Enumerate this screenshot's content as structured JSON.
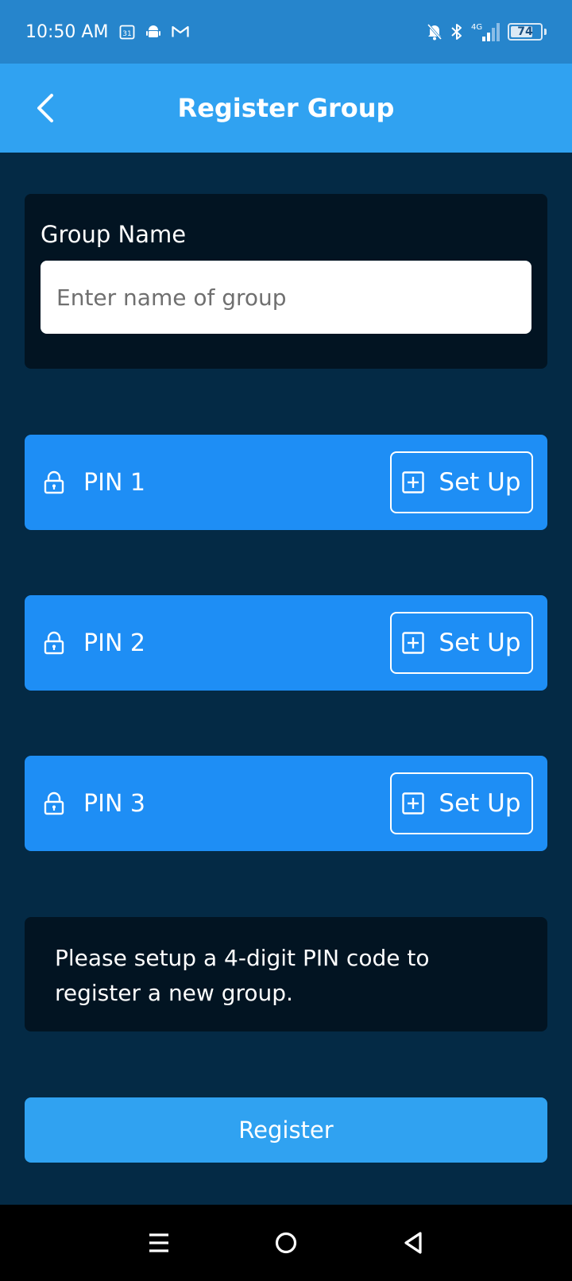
{
  "status_bar": {
    "time": "10:50 AM",
    "calendar_badge": "31",
    "network": "4G",
    "battery_level": 74,
    "battery_text": "74",
    "icons": [
      "calendar-icon",
      "android-icon",
      "gmail-icon",
      "bell-off-icon",
      "bluetooth-icon",
      "signal-icon",
      "battery-icon"
    ]
  },
  "app_bar": {
    "title": "Register Group",
    "back_icon": "chevron-left-icon"
  },
  "group_form": {
    "label": "Group Name",
    "value": "",
    "placeholder": "Enter name of group"
  },
  "pins": [
    {
      "label": "PIN 1",
      "action_label": "Set Up"
    },
    {
      "label": "PIN 2",
      "action_label": "Set Up"
    },
    {
      "label": "PIN 3",
      "action_label": "Set Up"
    }
  ],
  "info": {
    "message": "Please setup a 4-digit PIN code to register a new group."
  },
  "register_button": {
    "label": "Register"
  },
  "colors": {
    "status_bar": "#2685cc",
    "app_bar": "#30a2f1",
    "background": "#042a45",
    "card_dark": "#021422",
    "pin_row": "#1e8ef5",
    "register": "#30a2f1"
  },
  "nav_bar": {
    "icons": [
      "menu-icon",
      "home-circle-icon",
      "back-triangle-icon"
    ]
  }
}
